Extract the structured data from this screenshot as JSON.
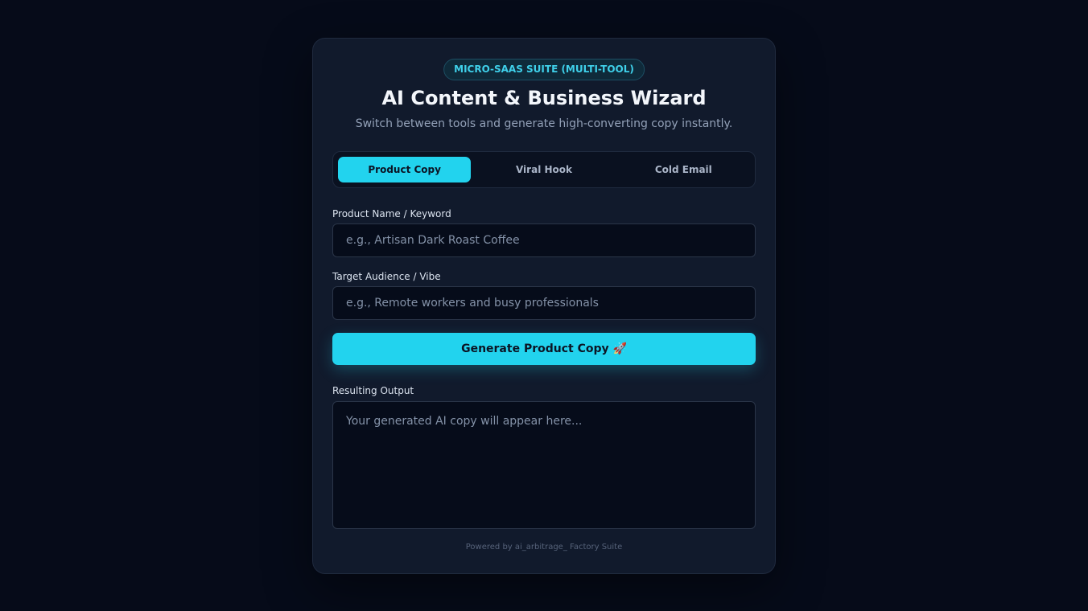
{
  "badge": "MICRO-SAAS SUITE (MULTI-TOOL)",
  "title": "AI Content & Business Wizard",
  "subtitle": "Switch between tools and generate high-converting copy instantly.",
  "tabs": [
    {
      "label": "Product Copy",
      "active": true
    },
    {
      "label": "Viral Hook",
      "active": false
    },
    {
      "label": "Cold Email",
      "active": false
    }
  ],
  "fields": {
    "product": {
      "label": "Product Name / Keyword",
      "placeholder": "e.g., Artisan Dark Roast Coffee",
      "value": ""
    },
    "audience": {
      "label": "Target Audience / Vibe",
      "placeholder": "e.g., Remote workers and busy professionals",
      "value": ""
    }
  },
  "generate_button": "Generate Product Copy 🚀",
  "output": {
    "label": "Resulting Output",
    "placeholder": "Your generated AI copy will appear here...",
    "value": ""
  },
  "footer": "Powered by ai_arbitrage_ Factory Suite",
  "colors": {
    "accent": "#22d3ee",
    "background": "#060b19",
    "card": "#111a2c"
  }
}
